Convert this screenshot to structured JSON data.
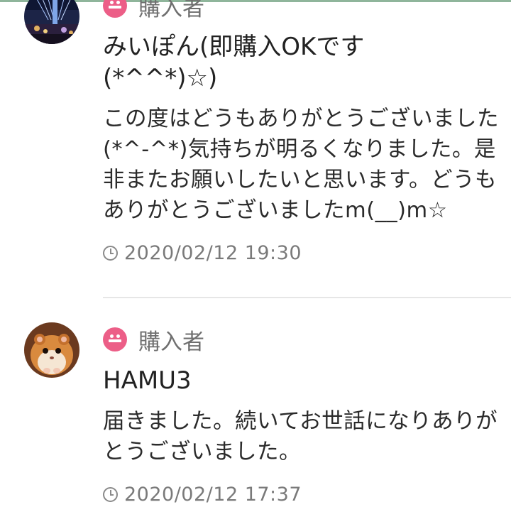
{
  "reviews": [
    {
      "role": "購入者",
      "username_line1": "みいぽん(即購入OKです",
      "username_line2": "(*^^*)☆)",
      "comment": "この度はどうもありがとうございました(*^-^*)気持ちが明るくなりました。是非またお願いしたいと思います。どうもありがとうございましたm(__)m☆",
      "timestamp": "2020/02/12 19:30"
    },
    {
      "role": "購入者",
      "username": "HAMU3",
      "comment": "届きました。続いてお世話になりありがとうございました。",
      "timestamp": "2020/02/12 17:37"
    }
  ],
  "colors": {
    "role_icon": "#ec5e87",
    "text": "#222222",
    "muted": "#7a7a7a"
  }
}
